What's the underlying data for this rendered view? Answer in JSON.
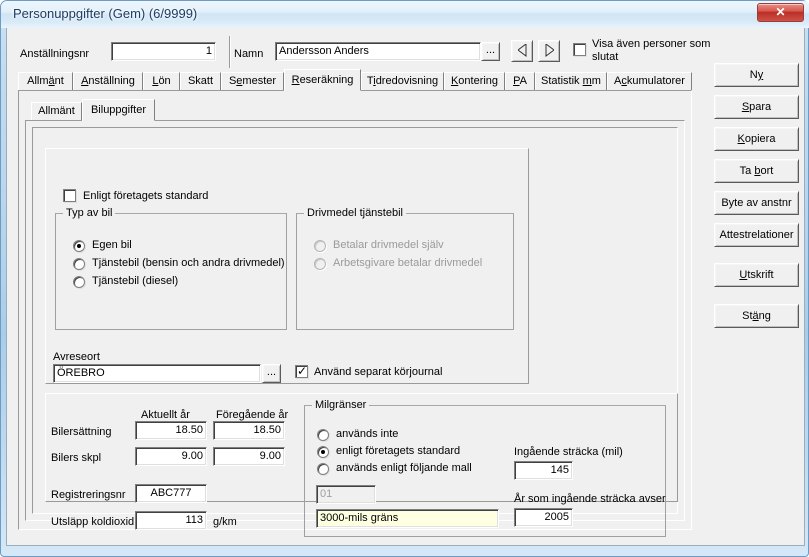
{
  "window": {
    "title": "Personuppgifter (Gem) (6/9999)",
    "close_label": "✕",
    "close_icon": "close-icon"
  },
  "header": {
    "employee_no_label": "Anställningsnr",
    "employee_no_value": "1",
    "name_label": "Namn",
    "name_value": "Andersson Anders",
    "name_browse_label": "...",
    "prev_icon": "triangle-left-icon",
    "next_icon": "triangle-right-icon",
    "show_former_label": "Visa även personer som slutat",
    "show_former_checked": false
  },
  "main_tabs": [
    {
      "label": "Allmänt",
      "accel": 3,
      "selected": false
    },
    {
      "label": "Anställning",
      "accel": 0,
      "selected": false
    },
    {
      "label": "Lön",
      "accel": 0,
      "selected": false
    },
    {
      "label": "Skatt",
      "accel": -1,
      "selected": false
    },
    {
      "label": "Semester",
      "accel": 1,
      "selected": false
    },
    {
      "label": "Reseräkning",
      "accel": 0,
      "selected": true
    },
    {
      "label": "Tidredovisning",
      "accel": 1,
      "selected": false
    },
    {
      "label": "Kontering",
      "accel": 0,
      "selected": false
    },
    {
      "label": "PA",
      "accel": 0,
      "selected": false
    },
    {
      "label": "Statistik mm",
      "accel": 9,
      "selected": false
    },
    {
      "label": "Ackumulatorer",
      "accel": 1,
      "selected": false
    }
  ],
  "sub_tabs": [
    {
      "label": "Allmänt",
      "selected": false
    },
    {
      "label": "Biluppgifter",
      "selected": true
    }
  ],
  "form": {
    "company_standard_label": "Enligt företagets standard",
    "company_standard_checked": false,
    "car_type": {
      "title": "Typ av bil",
      "options": [
        {
          "label": "Egen bil",
          "selected": true
        },
        {
          "label": "Tjänstebil (bensin och andra drivmedel)",
          "selected": false
        },
        {
          "label": "Tjänstebil (diesel)",
          "selected": false
        }
      ]
    },
    "fuel": {
      "title": "Drivmedel tjänstebil",
      "disabled": true,
      "options": [
        {
          "label": "Betalar drivmedel själv",
          "selected": false
        },
        {
          "label": "Arbetsgivare betalar drivmedel",
          "selected": false
        }
      ]
    },
    "departure": {
      "label": "Avreseort",
      "value": "ÖREBRO",
      "browse_label": "..."
    },
    "separate_logbook_label": "Använd separat körjournal",
    "separate_logbook_checked": true,
    "columns": {
      "current_year": "Aktuellt år",
      "previous_year": "Föregående år"
    },
    "rows": [
      {
        "label": "Bilersättning",
        "current": "18.50",
        "previous": "18.50"
      },
      {
        "label": "Bilers skpl",
        "current": "9.00",
        "previous": "9.00"
      }
    ],
    "registration": {
      "label": "Registreringsnr",
      "value": "ABC777"
    },
    "co2": {
      "label": "Utsläpp koldioxid",
      "value": "113",
      "unit": "g/km"
    },
    "mileage": {
      "title": "Milgränser",
      "options": [
        {
          "label": "används inte",
          "selected": false
        },
        {
          "label": "enligt företagets standard",
          "selected": true
        },
        {
          "label": "används enligt följande mall",
          "selected": false
        }
      ],
      "template_code": "01",
      "template_name": "3000-mils gräns",
      "opening_distance_label": "Ingående sträcka (mil)",
      "opening_distance_value": "145",
      "opening_year_label": "År som ingående sträcka avser",
      "opening_year_value": "2005"
    }
  },
  "side_buttons": [
    {
      "label": "Ny",
      "accel": 1
    },
    {
      "label": "Spara",
      "accel": 0
    },
    {
      "label": "Kopiera",
      "accel": 0
    },
    {
      "label": "Ta bort",
      "accel": 3
    },
    {
      "label": "Byte av anstnr",
      "accel": -1
    },
    {
      "label": "Attestrelationer",
      "accel": 1
    },
    {
      "label": "Utskrift",
      "accel": 0
    },
    {
      "label": "Stäng",
      "accel": 2
    }
  ],
  "colors": {
    "face": "#f0f0f0",
    "aero_glass": "#b4d4ec",
    "close_red": "#c13b31",
    "highlight_field": "#ffffe1",
    "title_text": "#1d3d63"
  }
}
